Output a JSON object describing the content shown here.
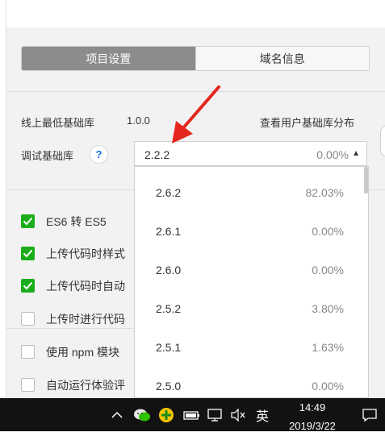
{
  "tabs": {
    "project_settings": "项目设置",
    "domain_info": "域名信息"
  },
  "baselib": {
    "online_min_label": "线上最低基础库",
    "online_min_value": "1.0.0",
    "view_distribution_link": "查看用户基础库分布",
    "debug_label": "调试基础库",
    "help_glyph": "?",
    "selected_version": "2.2.2",
    "selected_percent": "0.00%",
    "caret_glyph": "▲"
  },
  "dropdown_options": [
    {
      "version": "2.6.2",
      "percent": "82.03%"
    },
    {
      "version": "2.6.1",
      "percent": "0.00%"
    },
    {
      "version": "2.6.0",
      "percent": "0.00%"
    },
    {
      "version": "2.5.2",
      "percent": "3.80%"
    },
    {
      "version": "2.5.1",
      "percent": "1.63%"
    },
    {
      "version": "2.5.0",
      "percent": "0.00%"
    }
  ],
  "options": [
    {
      "label": "ES6 转 ES5",
      "checked": true
    },
    {
      "label": "上传代码时样式",
      "checked": true
    },
    {
      "label": "上传代码时自动",
      "checked": true
    },
    {
      "label": "上传时进行代码",
      "checked": false
    },
    {
      "label": "使用 npm 模块",
      "checked": false
    },
    {
      "label": "自动运行体验评",
      "checked": false
    }
  ],
  "taskbar": {
    "time": "14:49",
    "date": "2019/3/22",
    "ime": "英",
    "icons": [
      "chevron-up-icon",
      "wechat-icon",
      "plus-app-icon",
      "battery-icon",
      "network-icon",
      "volume-muted-icon",
      "ime-icon",
      "notification-icon"
    ]
  },
  "colors": {
    "accent_green": "#1aad19",
    "active_tab": "#8c8c8c",
    "arrow_red": "#e5261e"
  }
}
